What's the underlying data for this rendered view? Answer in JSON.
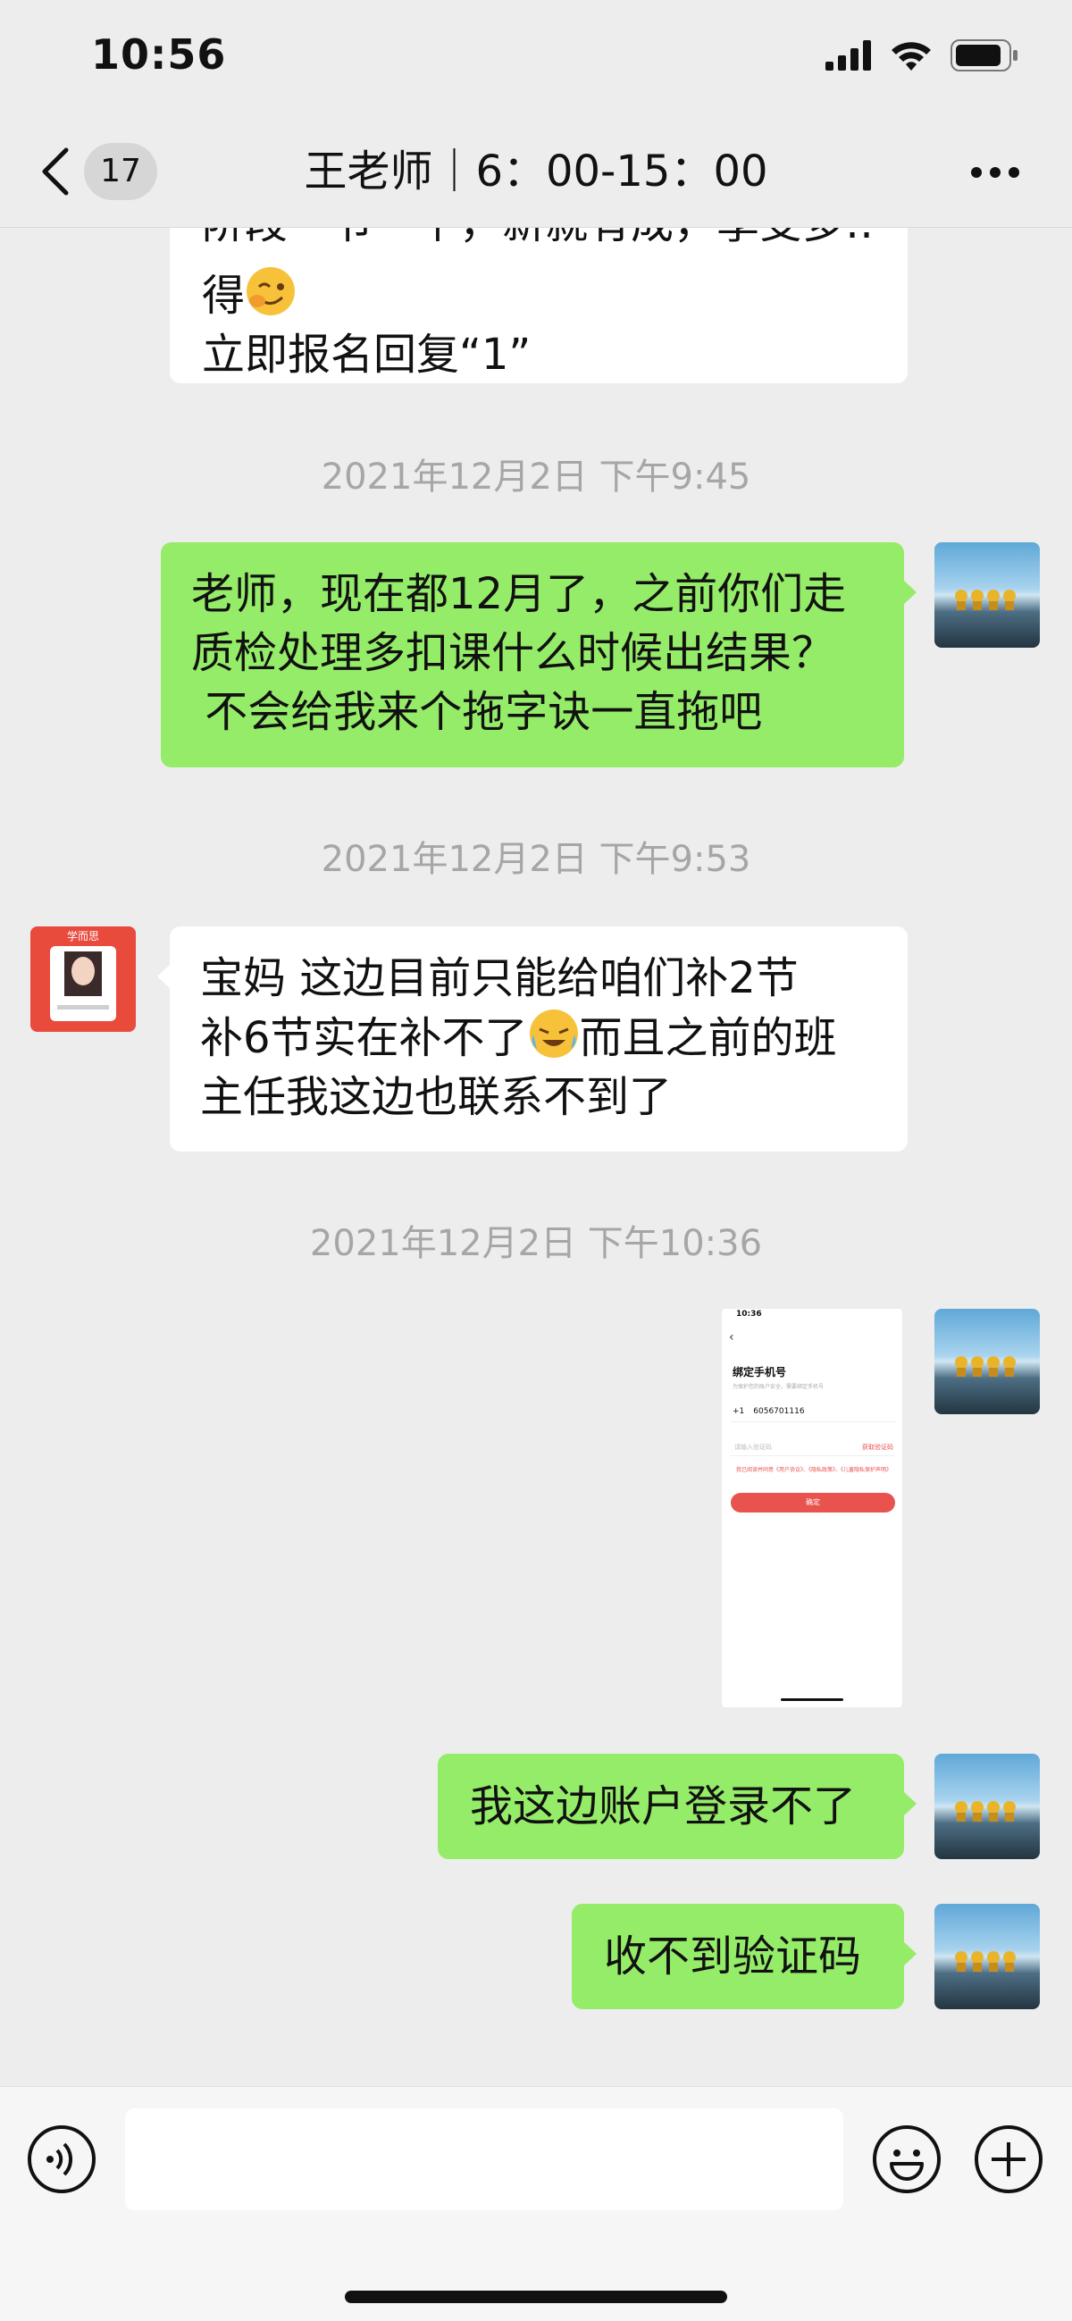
{
  "status_bar": {
    "time": "10:56"
  },
  "nav": {
    "unread_count": "17",
    "title": "王老师｜6：00-15：00"
  },
  "messages": [
    {
      "side": "in",
      "lines": [
        "得",
        "立即报名回复“1”"
      ]
    },
    {
      "type": "timestamp",
      "text": "2021年12月2日 下午9:45"
    },
    {
      "side": "out",
      "lines": [
        "老师，现在都12月了，之前你们走",
        "质检处理多扣课什么时候出结果？",
        " 不会给我来个拖字诀一直拖吧"
      ]
    },
    {
      "type": "timestamp",
      "text": "2021年12月2日 下午9:53"
    },
    {
      "side": "in",
      "lines": [
        "宝妈 这边目前只能给咱们补2节",
        "补6节实在补不了",
        "而且之前的班",
        "主任我这边也联系不到了"
      ]
    },
    {
      "type": "timestamp",
      "text": "2021年12月2日 下午10:36"
    },
    {
      "side": "out",
      "type": "image",
      "screenshot": {
        "time": "10:36",
        "title": "绑定手机号",
        "subtitle": "为保护您的账户安全，需要绑定手机号",
        "country_code": "+1",
        "phone": "6056701116",
        "code_placeholder": "请输入验证码",
        "resend": "获取验证码",
        "agreement": "我已阅读并同意《用户协议》、《隐私政策》、《儿童隐私保护声明》",
        "confirm": "确定"
      }
    },
    {
      "side": "out",
      "lines": [
        "我这边账户登录不了"
      ]
    },
    {
      "side": "out",
      "lines": [
        "收不到验证码"
      ]
    }
  ],
  "teacher_avatar": {
    "brand": "学而思"
  },
  "colors": {
    "outgoing_bubble": "#95ec69",
    "incoming_bubble": "#ffffff",
    "background": "#ededed",
    "timestamp": "#a6a6a6"
  },
  "icons": [
    "signal-icon",
    "wifi-icon",
    "battery-icon",
    "back-chevron-icon",
    "more-icon",
    "voice-icon",
    "emoji-icon",
    "plus-icon"
  ]
}
